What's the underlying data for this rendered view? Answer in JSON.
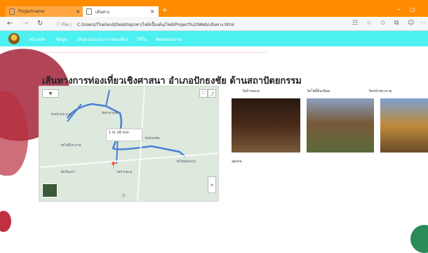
{
  "browser": {
    "tabs": [
      {
        "label": "Projectname"
      },
      {
        "label": "เส้นทาง"
      }
    ],
    "url_prefix": "File",
    "url": "C:/Users/Thailand/Desktop/เทา/ไฟล์เบื้องต้น/ไฟล์/Project%20Web/เส้นทาง.html"
  },
  "site": {
    "nav": [
      "หน้าหลัก",
      "ข้อมูล",
      "เส้นทางแนะนำการท่องเที่ยว",
      "วิดีโอ",
      "ติดต่อสอบถาม"
    ]
  },
  "page": {
    "title": "เส้นทางการท่องเที่ยวเชิงศาสนา อำเภอปักธงชัย ด้านสถาปัตยกรรม",
    "map": {
      "labels": [
        "วัดหน้าพระธาตุ",
        "วัดศาลาลอย",
        "วัดบ้านตะคุ",
        "วัดใหม่อัมพวัน",
        "วัดเมืองเก่า",
        "วัดปักธงชัย",
        "วัดโพธิ์ประสาท",
        "1 hr 28 min"
      ]
    },
    "photos": [
      {
        "title": "วัดบ้านตะคุ"
      },
      {
        "title": "วัดโพธิ์ต้องนิยม"
      },
      {
        "title": "วัดหน้าพระธาตุ"
      }
    ],
    "caption": "จุดเด่น"
  }
}
